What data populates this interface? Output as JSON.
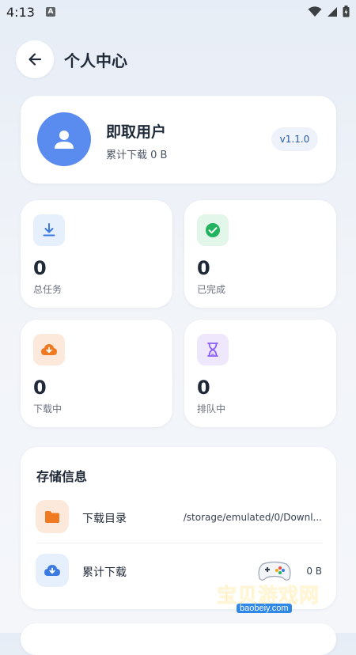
{
  "status_bar": {
    "time": "4:13",
    "notification_letter": "A"
  },
  "header": {
    "title": "个人中心"
  },
  "profile": {
    "name": "即取用户",
    "subtitle": "累计下载 0 B",
    "version": "v1.1.0"
  },
  "stats": [
    {
      "label": "总任务",
      "value": "0",
      "icon": "download-icon",
      "color": "#3b7ae0",
      "bg": "#e6effc"
    },
    {
      "label": "已完成",
      "value": "0",
      "icon": "check-circle-icon",
      "color": "#22b35e",
      "bg": "#e3f6ea"
    },
    {
      "label": "下载中",
      "value": "0",
      "icon": "cloud-download-icon",
      "color": "#f07a22",
      "bg": "#fde9dc"
    },
    {
      "label": "排队中",
      "value": "0",
      "icon": "hourglass-icon",
      "color": "#8b5cf6",
      "bg": "#efe8fd"
    }
  ],
  "storage": {
    "title": "存储信息",
    "rows": [
      {
        "label": "下载目录",
        "value": "/storage/emulated/0/Downl...",
        "icon": "folder-icon"
      },
      {
        "label": "累计下载",
        "value": "0 B",
        "icon": "cloud-download-icon"
      }
    ]
  },
  "watermark": {
    "text": "宝贝游戏网",
    "domain": "baobeiy.com"
  }
}
